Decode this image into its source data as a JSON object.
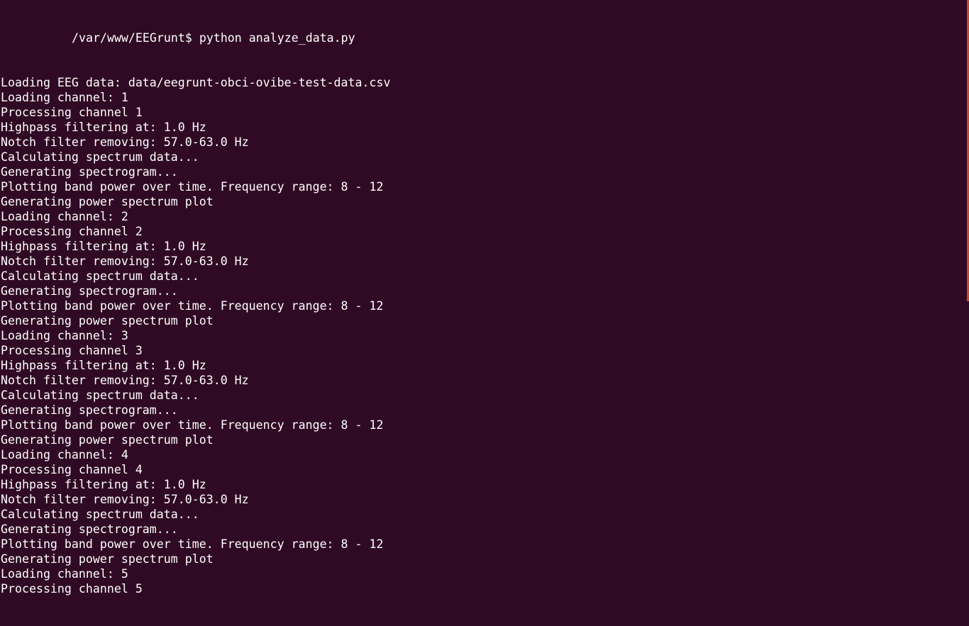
{
  "terminal": {
    "prompt": {
      "prefix": "",
      "cwd": "/var/www/EEGrunt$",
      "command": "python analyze_data.py"
    },
    "lines": [
      "Loading EEG data: data/eegrunt-obci-ovibe-test-data.csv",
      "Loading channel: 1",
      "Processing channel 1",
      "Highpass filtering at: 1.0 Hz",
      "Notch filter removing: 57.0-63.0 Hz",
      "Calculating spectrum data...",
      "Generating spectrogram...",
      "Plotting band power over time. Frequency range: 8 - 12",
      "Generating power spectrum plot",
      "Loading channel: 2",
      "Processing channel 2",
      "Highpass filtering at: 1.0 Hz",
      "Notch filter removing: 57.0-63.0 Hz",
      "Calculating spectrum data...",
      "Generating spectrogram...",
      "Plotting band power over time. Frequency range: 8 - 12",
      "Generating power spectrum plot",
      "Loading channel: 3",
      "Processing channel 3",
      "Highpass filtering at: 1.0 Hz",
      "Notch filter removing: 57.0-63.0 Hz",
      "Calculating spectrum data...",
      "Generating spectrogram...",
      "Plotting band power over time. Frequency range: 8 - 12",
      "Generating power spectrum plot",
      "Loading channel: 4",
      "Processing channel 4",
      "Highpass filtering at: 1.0 Hz",
      "Notch filter removing: 57.0-63.0 Hz",
      "Calculating spectrum data...",
      "Generating spectrogram...",
      "Plotting band power over time. Frequency range: 8 - 12",
      "Generating power spectrum plot",
      "Loading channel: 5",
      "Processing channel 5"
    ],
    "colors": {
      "background": "#300a24",
      "text": "#ffffff",
      "scrollbar": "#e95420"
    }
  }
}
